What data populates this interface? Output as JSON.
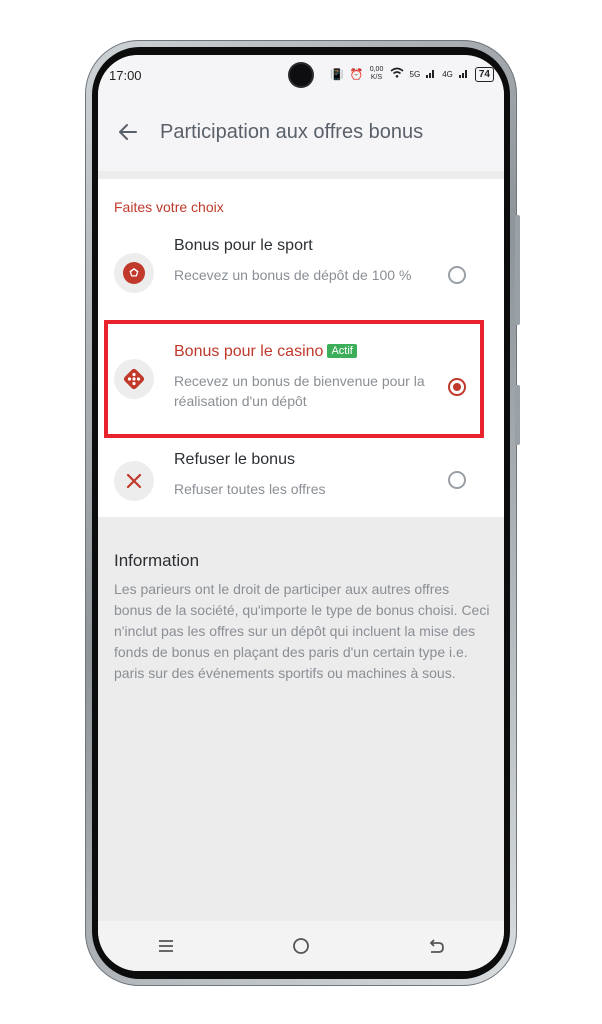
{
  "status_bar": {
    "time": "17:00",
    "network_speed": "0,00 K/S",
    "signal_1": "5G",
    "signal_2": "4G",
    "battery": "74"
  },
  "header": {
    "title": "Participation aux offres bonus"
  },
  "choices": {
    "section_label": "Faites votre choix",
    "options": [
      {
        "title": "Bonus pour le sport",
        "description": "Recevez un bonus de dépôt de 100 %",
        "icon": "soccer-ball-icon",
        "selected": false
      },
      {
        "title": "Bonus pour le casino",
        "badge": "Actif",
        "description": "Recevez un bonus de bienvenue pour la réalisation d'un dépôt",
        "icon": "dice-icon",
        "selected": true
      },
      {
        "title": "Refuser le bonus",
        "description": "Refuser toutes les offres",
        "icon": "close-icon",
        "selected": false
      }
    ]
  },
  "information": {
    "title": "Information",
    "text": "Les parieurs ont le droit de participer aux autres offres bonus de la société, qu'importe le type de bonus choisi. Ceci n'inclut pas les offres sur un dépôt qui incluent la mise des fonds de bonus en plaçant des paris d'un certain type i.e. paris sur des événements sportifs ou machines à sous."
  },
  "colors": {
    "accent": "#c0392b",
    "highlight_border": "#e8232d",
    "badge_green": "#3cae5a"
  }
}
